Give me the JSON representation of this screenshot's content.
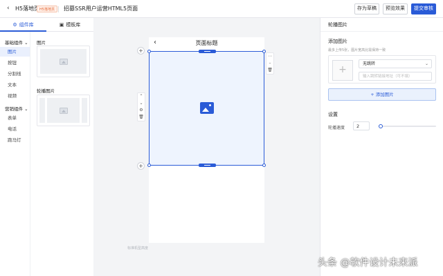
{
  "header": {
    "back_icon": "‹",
    "title": "H5落地页",
    "tag": "H5落地页",
    "page_name": "招募SSR用户运营HTML5页面",
    "buttons": {
      "save": "存为草稿",
      "preview": "预览效果",
      "submit": "提交审核"
    }
  },
  "left_tabs": {
    "components": "组件库",
    "templates": "模板库"
  },
  "categories": {
    "basic": {
      "title": "基础组件",
      "items": [
        "图片",
        "按钮",
        "分割线",
        "文本",
        "视频"
      ]
    },
    "marketing": {
      "title": "营销组件",
      "items": [
        "表单",
        "电话",
        "跑马灯"
      ]
    }
  },
  "components": {
    "image_label": "图片",
    "carousel_label": "轮播图片"
  },
  "canvas": {
    "page_title": "页面标题",
    "back_icon": "‹",
    "note": "标准机型高度"
  },
  "right_panel": {
    "title": "轮播图片",
    "add_image_section": "添加图片",
    "hint": "最多上传5张，图片宽高比需保持一致",
    "upload_plus": "+",
    "jump_select": "无跳转",
    "link_placeholder": "输入跳转链接地址（可不填）",
    "add_button": "+ 添加图片",
    "settings_title": "设置",
    "speed_label": "轮播速度",
    "speed_value": "2"
  },
  "colors": {
    "accent": "#2a5bd7",
    "tag": "#e4632f"
  },
  "watermark": "头条 @软件设计未来派"
}
